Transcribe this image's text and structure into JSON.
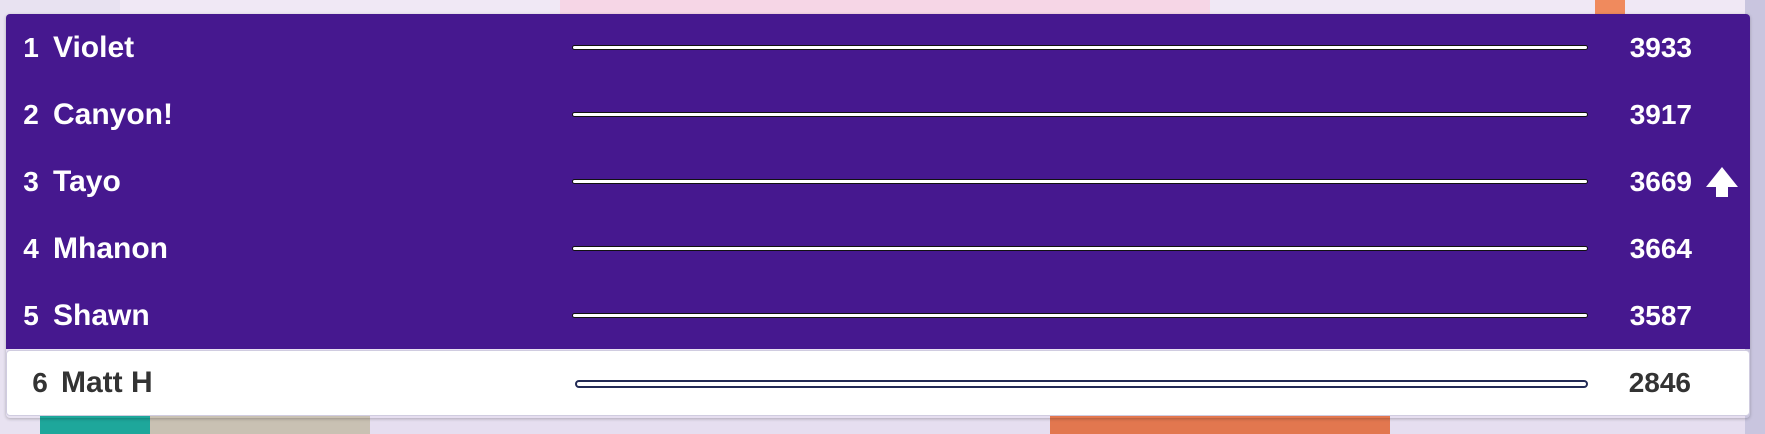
{
  "leaderboard": {
    "rows": [
      {
        "rank": "1",
        "name": "Violet",
        "score": "3933",
        "trend": ""
      },
      {
        "rank": "2",
        "name": "Canyon!",
        "score": "3917",
        "trend": ""
      },
      {
        "rank": "3",
        "name": "Tayo",
        "score": "3669",
        "trend": "up-arrow-icon"
      },
      {
        "rank": "4",
        "name": "Mhanon",
        "score": "3664",
        "trend": ""
      },
      {
        "rank": "5",
        "name": "Shawn",
        "score": "3587",
        "trend": ""
      }
    ],
    "current_player": {
      "rank": "6",
      "name": "Matt H",
      "score": "2846"
    }
  },
  "colors": {
    "row_background": "#46188f",
    "current_player_background": "#ffffff",
    "text_light": "#ffffff",
    "text_dark": "#333333"
  }
}
